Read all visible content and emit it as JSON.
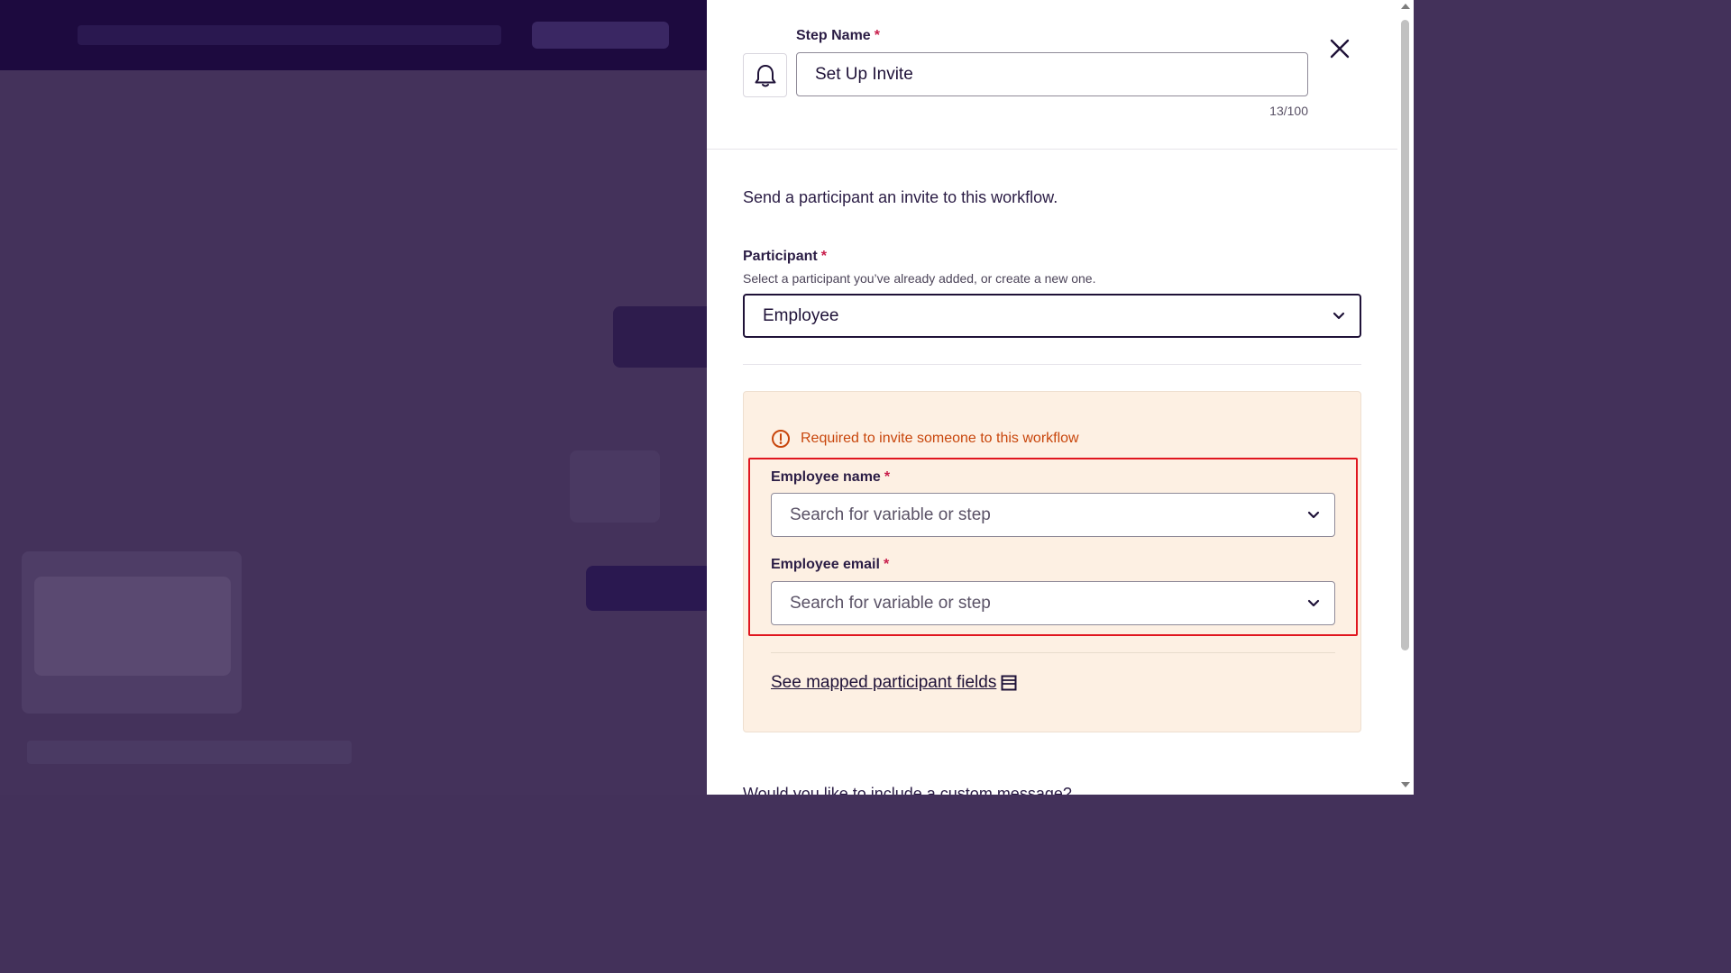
{
  "panel": {
    "step_name_label": "Step Name",
    "required_mark": "*",
    "step_name_value": "Set Up Invite",
    "step_name_counter": "13/100",
    "description": "Send a participant an invite to this workflow.",
    "participant_label": "Participant",
    "participant_hint": "Select a participant you’ve already added, or create a new one.",
    "participant_value": "Employee",
    "warning_text": "Required to invite someone to this workflow",
    "employee_name_label": "Employee name",
    "employee_name_placeholder": "Search for variable or step",
    "employee_email_label": "Employee email",
    "employee_email_placeholder": "Search for variable or step",
    "mapped_link": "See mapped participant fields",
    "custom_message_question": "Would you like to include a custom message?"
  },
  "icons": {
    "step_icon": "bell-icon",
    "close": "close-icon",
    "dropdown": "chevron-down-icon",
    "warning": "alert-circle-icon",
    "mapped": "panel-icon"
  },
  "colors": {
    "overlay": "#44325b",
    "header_dark": "#1d0a3f",
    "required": "#c81d4b",
    "warning_text": "#c8460c",
    "warning_bg": "#fdf0e3",
    "highlight_border": "#e0161f"
  }
}
